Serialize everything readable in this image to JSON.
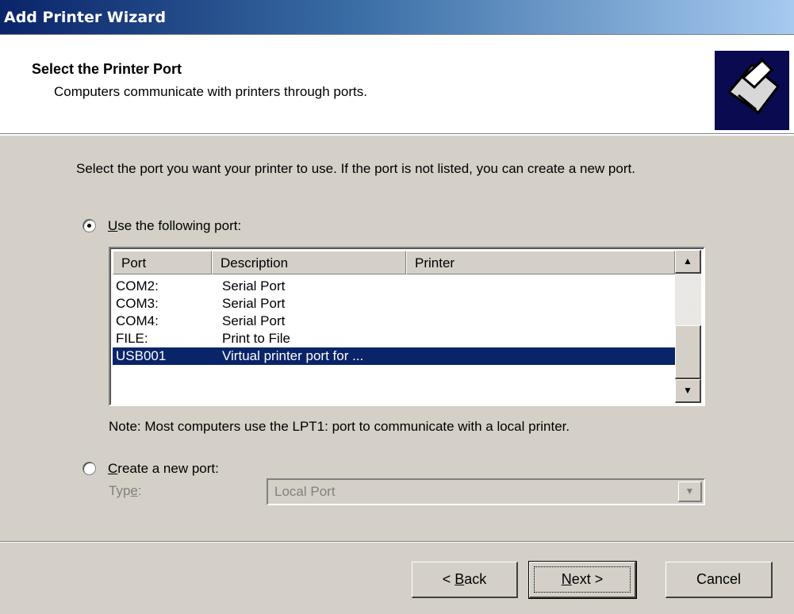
{
  "window": {
    "title": "Add Printer Wizard"
  },
  "header": {
    "title": "Select the Printer Port",
    "subtitle": "Computers communicate with printers through ports.",
    "icon": "printer-icon"
  },
  "intro": "Select the port you want your printer to use.  If the port is not listed, you can create a new port.",
  "use_port": {
    "selected": true,
    "label_accel": "U",
    "label_rest": "se the following port:"
  },
  "port_list": {
    "columns": [
      "Port",
      "Description",
      "Printer"
    ],
    "rows": [
      {
        "port": "COM2:",
        "description": "Serial Port",
        "printer": ""
      },
      {
        "port": "COM3:",
        "description": "Serial Port",
        "printer": ""
      },
      {
        "port": "COM4:",
        "description": "Serial Port",
        "printer": ""
      },
      {
        "port": "FILE:",
        "description": "Print to File",
        "printer": ""
      },
      {
        "port": "USB001",
        "description": "Virtual printer port for ...",
        "printer": "",
        "selected": true
      }
    ]
  },
  "note": "Note: Most computers use the LPT1: port to communicate with a local printer.",
  "create_port": {
    "selected": false,
    "label_accel": "C",
    "label_rest": "reate a new port:",
    "type_label_prefix": "Typ",
    "type_label_accel": "e",
    "type_label_suffix": ":",
    "type_value": "Local Port"
  },
  "buttons": {
    "back_prefix": "< ",
    "back_accel": "B",
    "back_rest": "ack",
    "next_accel": "N",
    "next_rest": "ext >",
    "cancel": "Cancel"
  }
}
